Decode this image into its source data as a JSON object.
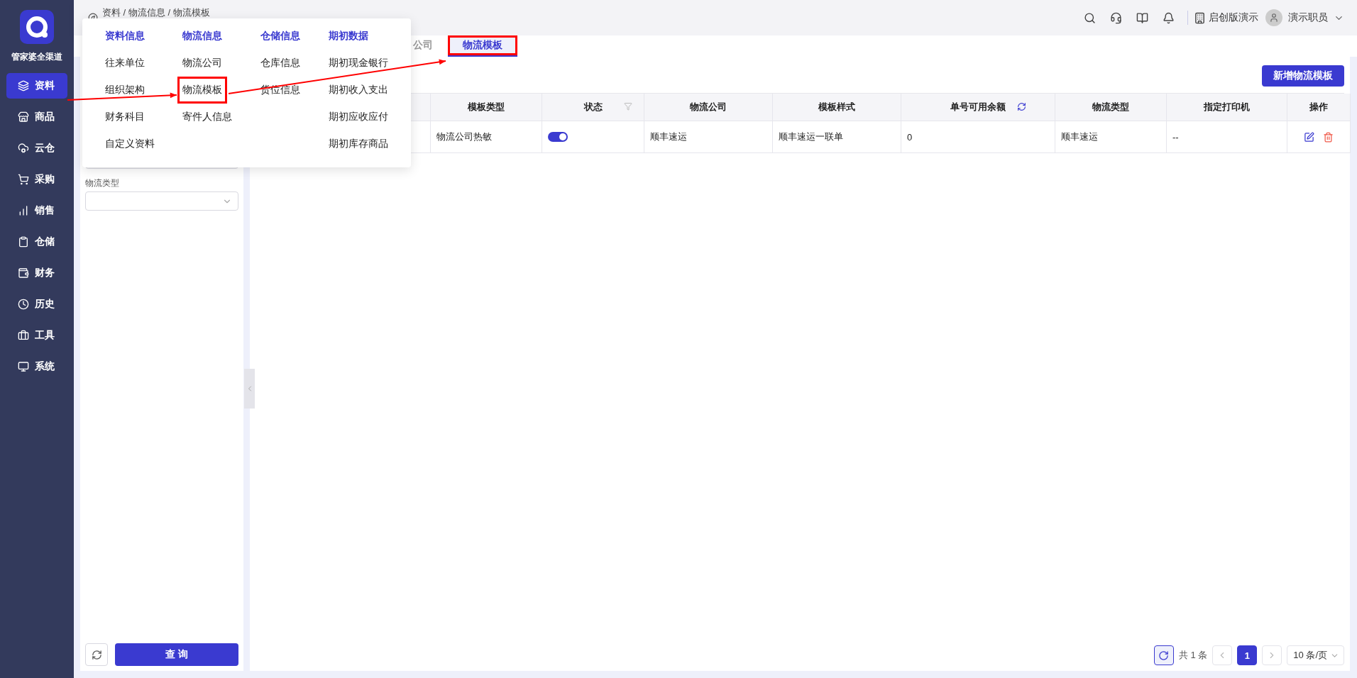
{
  "sidebar": {
    "brand": "管家婆全渠道",
    "items": [
      {
        "label": "资料",
        "selected": true
      },
      {
        "label": "商品",
        "selected": false
      },
      {
        "label": "云仓",
        "selected": false
      },
      {
        "label": "采购",
        "selected": false
      },
      {
        "label": "销售",
        "selected": false
      },
      {
        "label": "仓储",
        "selected": false
      },
      {
        "label": "财务",
        "selected": false
      },
      {
        "label": "历史",
        "selected": false
      },
      {
        "label": "工具",
        "selected": false
      },
      {
        "label": "系统",
        "selected": false
      }
    ]
  },
  "breadcrumb": "资料 / 物流信息 / 物流模板",
  "topbar": {
    "company": "启创版演示",
    "user": "演示职员"
  },
  "menu": {
    "columns": [
      {
        "title": "资料信息",
        "items": [
          {
            "label": "往来单位",
            "highlighted": false
          },
          {
            "label": "组织架构",
            "highlighted": false
          },
          {
            "label": "财务科目",
            "highlighted": false
          },
          {
            "label": "自定义资料",
            "highlighted": false
          }
        ]
      },
      {
        "title": "物流信息",
        "items": [
          {
            "label": "物流公司",
            "highlighted": false
          },
          {
            "label": "物流模板",
            "highlighted": true
          },
          {
            "label": "寄件人信息",
            "highlighted": false
          }
        ]
      },
      {
        "title": "仓储信息",
        "items": [
          {
            "label": "仓库信息",
            "highlighted": false
          },
          {
            "label": "货位信息",
            "highlighted": false
          }
        ]
      },
      {
        "title": "期初数据",
        "items": [
          {
            "label": "期初现金银行",
            "highlighted": false
          },
          {
            "label": "期初收入支出",
            "highlighted": false
          },
          {
            "label": "期初应收应付",
            "highlighted": false
          },
          {
            "label": "期初库存商品",
            "highlighted": false
          }
        ]
      }
    ]
  },
  "tabs": [
    {
      "label": "公司",
      "selected": false,
      "highlighted": false
    },
    {
      "label": "物流模板",
      "selected": true,
      "highlighted": true
    }
  ],
  "filter": {
    "fields": [
      {
        "kind": "input"
      },
      {
        "kind": "select",
        "label": "物流类型"
      }
    ],
    "query_button": "查 询"
  },
  "add_button": "新增物流模板",
  "table": {
    "columns": [
      {
        "kind": "blank"
      },
      {
        "label": "模板类型",
        "kind": "text"
      },
      {
        "label": "状态",
        "kind": "toggle",
        "filter": true
      },
      {
        "label": "物流公司",
        "kind": "text"
      },
      {
        "label": "模板样式",
        "kind": "text"
      },
      {
        "label": "单号可用余额",
        "kind": "text",
        "refresh": true
      },
      {
        "label": "物流类型",
        "kind": "text"
      },
      {
        "label": "指定打印机",
        "kind": "text"
      },
      {
        "label": "操作",
        "kind": "actions"
      }
    ],
    "rows": [
      {
        "cells": [
          "",
          "物流公司热敏",
          "",
          "顺丰速运",
          "顺丰速运一联单",
          "0",
          "顺丰速运",
          "--",
          ""
        ],
        "on": true
      }
    ]
  },
  "pagination": {
    "total": "共 1 条",
    "pages": [
      {
        "label": "1",
        "selected": true
      }
    ],
    "page_size": "10 条/页"
  }
}
